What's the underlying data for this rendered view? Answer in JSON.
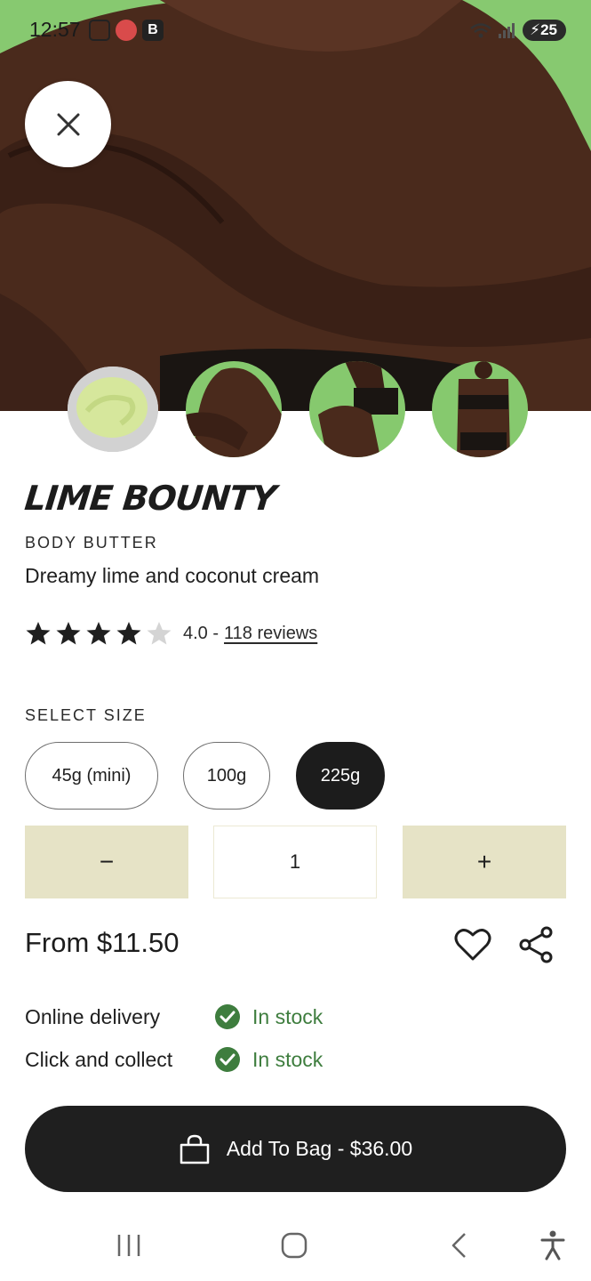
{
  "status_bar": {
    "time": "12:57",
    "notification_badge": "B",
    "battery": "25"
  },
  "product": {
    "title": "LIME BOUNTY",
    "category": "BODY BUTTER",
    "tagline": "Dreamy lime and coconut cream",
    "rating_value": 4.0,
    "rating_max": 5,
    "rating_text": "4.0 -",
    "reviews_text": "118 reviews",
    "price": "From $11.50"
  },
  "gallery": {
    "thumbnails": [
      {
        "icon": "lime-cream-product-image"
      },
      {
        "icon": "model-shoulder-image"
      },
      {
        "icon": "model-legs-image"
      },
      {
        "icon": "model-torso-image"
      }
    ],
    "selected_index": 0
  },
  "size": {
    "label": "SELECT SIZE",
    "options": [
      "45g (mini)",
      "100g",
      "225g"
    ],
    "selected": "225g"
  },
  "quantity": {
    "decrement": "−",
    "value": "1",
    "increment": "+"
  },
  "availability": [
    {
      "label": "Online delivery",
      "status": "In stock"
    },
    {
      "label": "Click and collect",
      "status": "In stock"
    }
  ],
  "cta": {
    "label": "Add To Bag - $36.00"
  },
  "colors": {
    "accent_green": "#3e7d3e",
    "qty_button_bg": "#e6e3c6",
    "dark": "#1f1f1f",
    "hero_bg": "#86c96e"
  },
  "icons": {
    "close": "close-icon",
    "wishlist": "heart-icon",
    "share": "share-icon",
    "bag": "shopping-bag-icon",
    "in_stock": "check-circle-icon",
    "nav_recents": "recents-icon",
    "nav_home": "home-icon",
    "nav_back": "back-icon",
    "nav_accessibility": "accessibility-icon"
  }
}
